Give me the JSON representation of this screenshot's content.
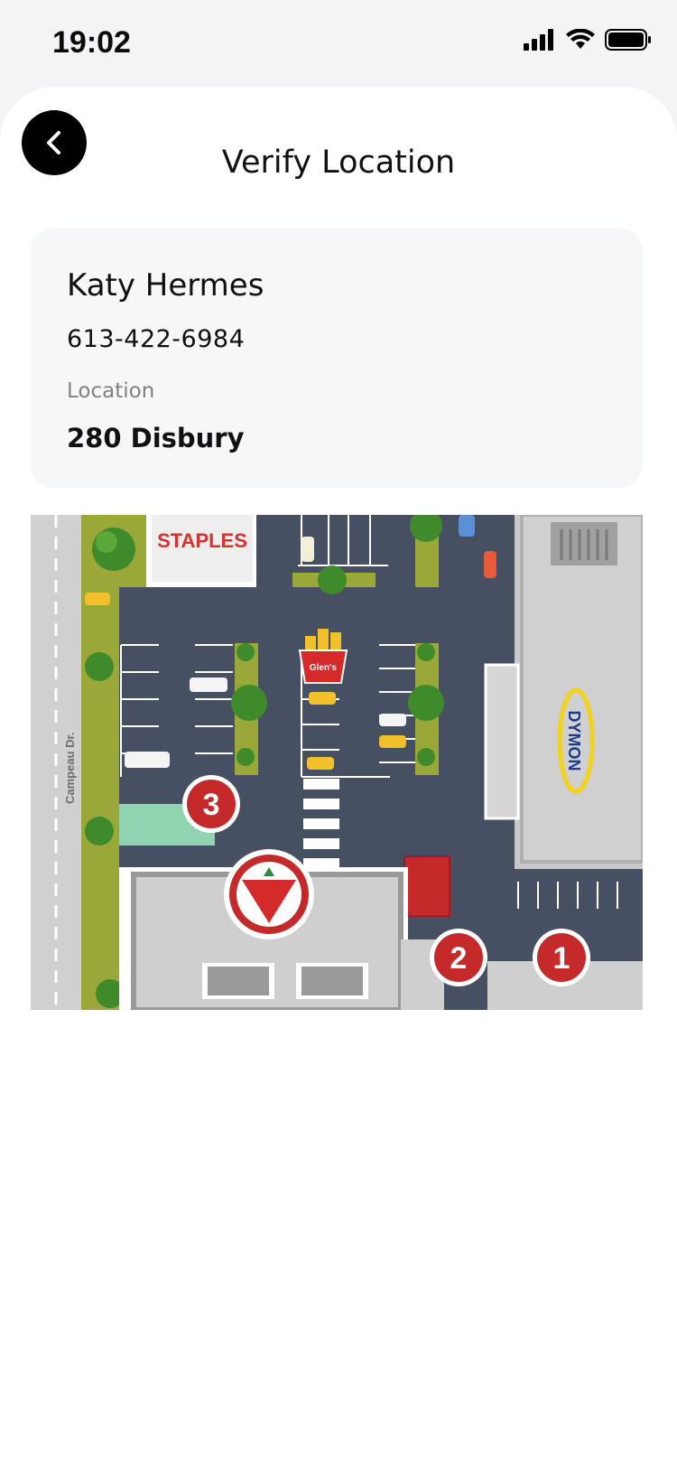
{
  "status_bar": {
    "time": "19:02",
    "icons": [
      "signal-icon",
      "wifi-icon",
      "battery-icon"
    ]
  },
  "header": {
    "title": "Verify Location",
    "back_icon": "chevron-left-icon"
  },
  "contact": {
    "name": "Katy Hermes",
    "phone": "613-422-6984",
    "location_label": "Location",
    "location_value": "280 Disbury"
  },
  "map": {
    "labels": {
      "store_left": "STAPLES",
      "store_right": "DYMON",
      "street": "Campeau Dr.",
      "restaurant": "Glen's"
    },
    "markers": [
      "3",
      "2",
      "1"
    ],
    "colors": {
      "road": "#475062",
      "grass": "#9aa83a",
      "marker_red": "#c42a2a",
      "building": "#cfcfcf"
    }
  }
}
